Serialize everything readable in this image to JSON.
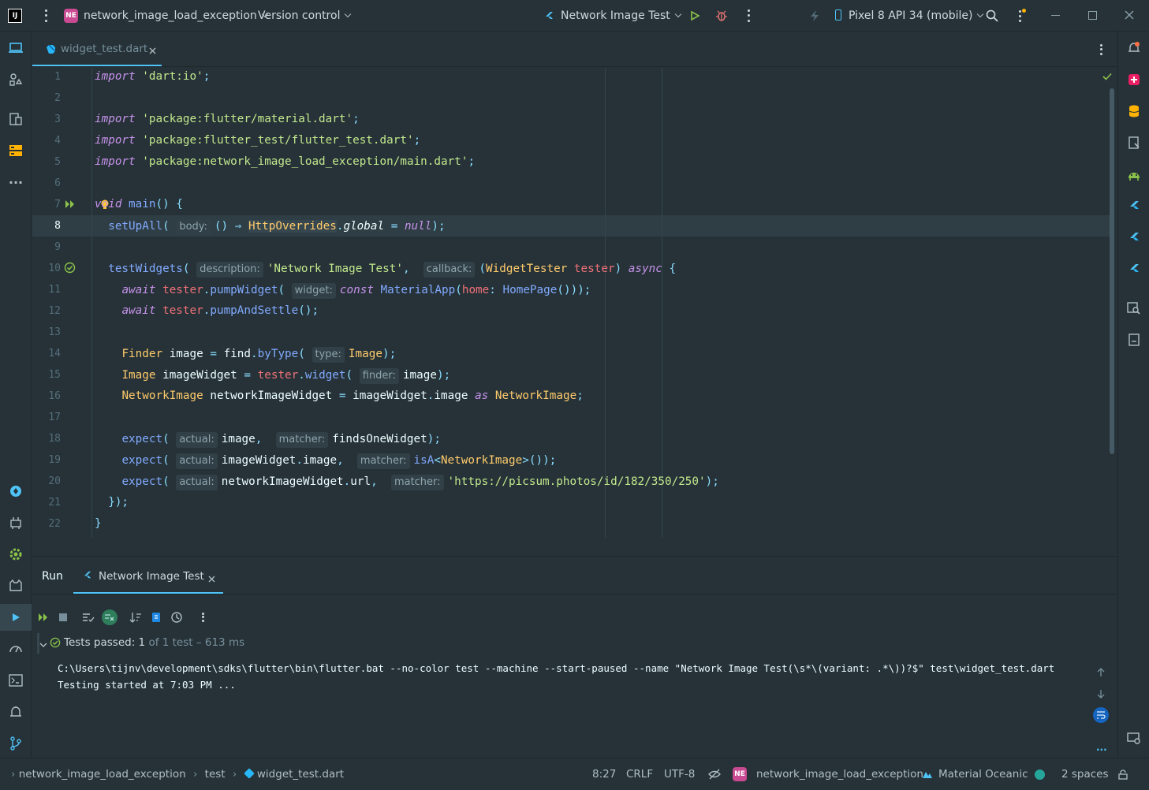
{
  "titlebar": {
    "project_badge": "NE",
    "project_name": "network_image_load_exception",
    "vcs": "Version control",
    "run_config": "Network Image Test",
    "device": "Pixel 8 API 34 (mobile)"
  },
  "editor_tab": {
    "label": "widget_test.dart"
  },
  "code_lines": {
    "l1": "import 'dart:io';",
    "l3": "import 'package:flutter/material.dart';",
    "l4": "import 'package:flutter_test/flutter_test.dart';",
    "l5": "import 'package:network_image_load_exception/main.dart';"
  },
  "line_numbers": [
    "1",
    "2",
    "3",
    "4",
    "5",
    "6",
    "7",
    "8",
    "9",
    "10",
    "11",
    "12",
    "13",
    "14",
    "15",
    "16",
    "17",
    "18",
    "19",
    "20",
    "21",
    "22"
  ],
  "hints": {
    "body": "body:",
    "description": "description:",
    "callback": "callback:",
    "widget": "widget:",
    "type": "type:",
    "finder": "finder:",
    "actual": "actual:",
    "matcher": "matcher:"
  },
  "run_panel": {
    "run_tab": "Run",
    "config_tab": "Network Image Test",
    "tests_passed": "Tests passed:",
    "tests_count": "1",
    "tests_detail": "of 1 test – 613 ms",
    "console_line1": "C:\\Users\\tijnv\\development\\sdks\\flutter\\bin\\flutter.bat --no-color test --machine --start-paused --name \"Network Image Test(\\s*\\(variant: .*\\))?$\" test\\widget_test.dart",
    "console_line2": "Testing started at 7:03 PM ..."
  },
  "statusbar": {
    "crumb_project": "network_image_load_exception",
    "crumb_folder": "test",
    "crumb_file": "widget_test.dart",
    "position": "8:27",
    "line_sep": "CRLF",
    "encoding": "UTF-8",
    "project_badge": "NE",
    "project_name": "network_image_load_exception",
    "theme": "Material Oceanic",
    "indent": "2 spaces"
  },
  "colors": {
    "background": "#263238",
    "accent": "#4fc3f7",
    "keyword": "#c792ea",
    "string": "#c3e88d",
    "function": "#82aaff",
    "type": "#ffcb6b",
    "success": "#4caf50"
  }
}
